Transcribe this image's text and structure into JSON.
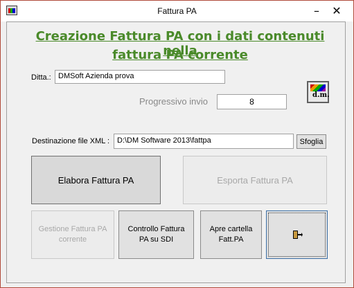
{
  "window": {
    "title": "Fattura PA"
  },
  "header": {
    "line1": "Creazione Fattura PA con i dati contenuti nella",
    "line2": "fattura PA corrente"
  },
  "form": {
    "ditta_label": "Ditta.:",
    "ditta_value": "DMSoft Azienda prova",
    "progressivo_label": "Progressivo invio",
    "progressivo_value": "8",
    "dest_label": "Destinazione file XML :",
    "dest_value": "D:\\DM Software 2013\\fattpa",
    "sfoglia_label": "Sfoglia"
  },
  "buttons": {
    "elabora": "Elabora Fattura PA",
    "esporta": "Esporta Fattura PA",
    "gestione_l1": "Gestione Fattura PA",
    "gestione_l2": "corrente",
    "controllo_l1": "Controllo Fattura",
    "controllo_l2": "PA su SDI",
    "apre_l1": "Apre cartella",
    "apre_l2": "Fatt.PA"
  },
  "icons": {
    "app": "dm-app-icon",
    "logo": "dm-logo-icon",
    "exit": "exit-door-icon"
  }
}
